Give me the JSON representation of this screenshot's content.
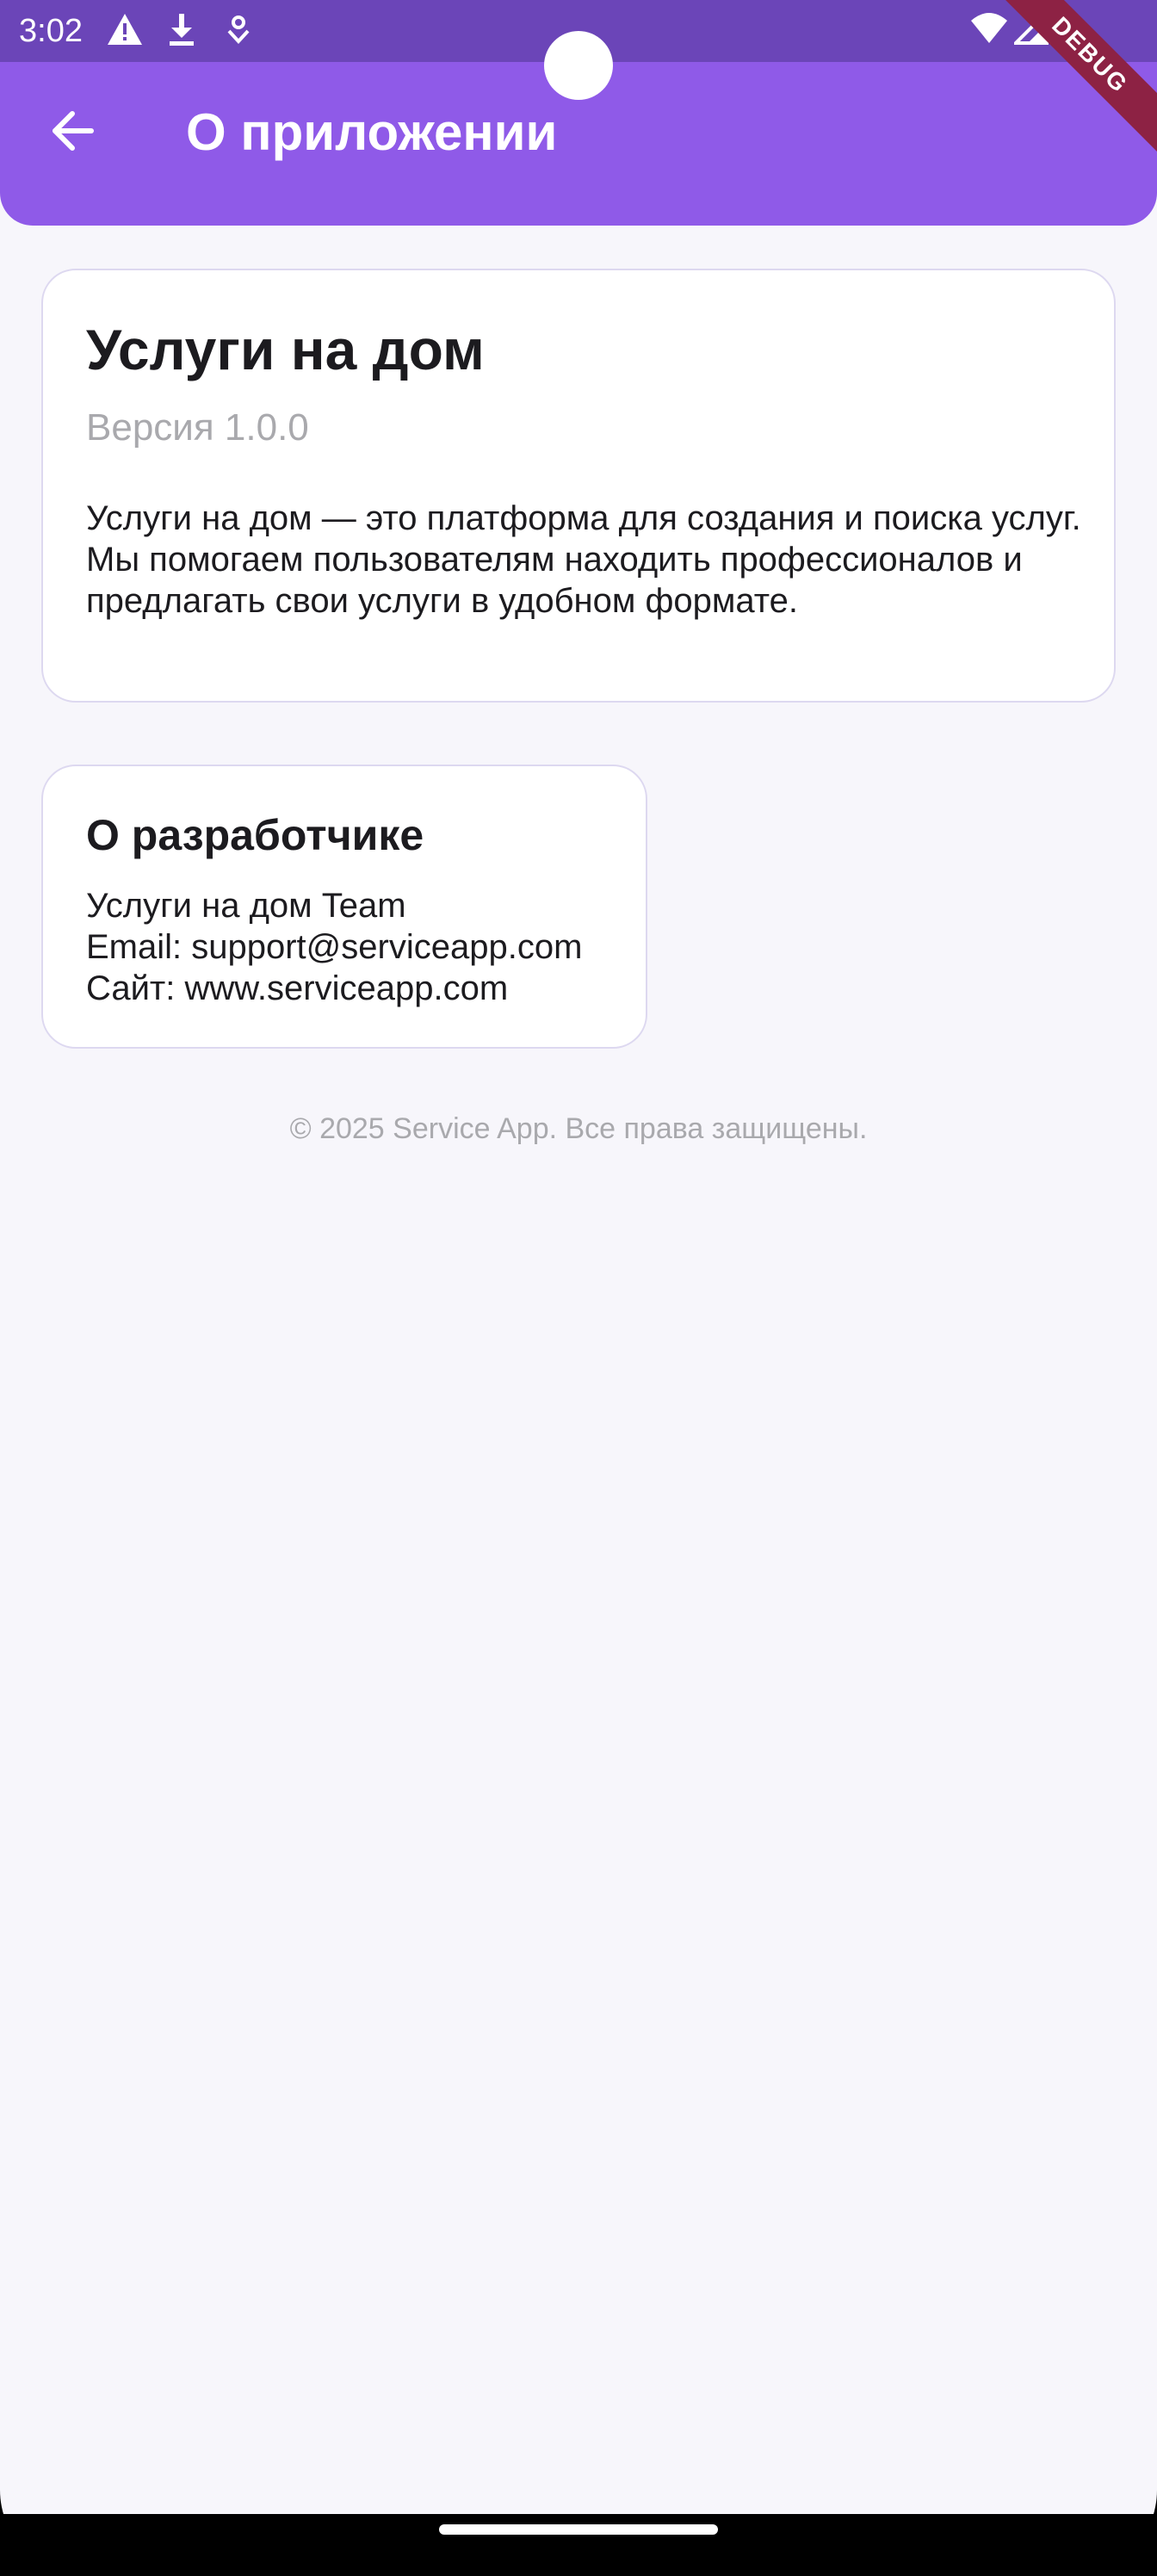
{
  "status_bar": {
    "time": "3:02",
    "left_icons": [
      "warning-icon",
      "download-icon",
      "tether-icon"
    ],
    "right_icons": [
      "wifi-icon",
      "signal-icon"
    ]
  },
  "debug_banner": "DEBUG",
  "app_bar": {
    "back_icon": "arrow-back-icon",
    "title": "О приложении",
    "color": "#8f5ae8"
  },
  "about_card": {
    "title": "Услуги на дом",
    "version": "Версия 1.0.0",
    "description": "Услуги на дом — это платформа для создания и поиска услуг. Мы помогаем пользователям находить профессионалов и предлагать свои услуги в удобном формате."
  },
  "developer_card": {
    "title": "О разработчике",
    "team": "Услуги на дом Team",
    "email": "Email: support@serviceapp.com",
    "site": "Сайт: www.serviceapp.com"
  },
  "footer": {
    "copyright": "© 2025 Service App. Все права защищены."
  },
  "colors": {
    "status_bar": "#6b45b8",
    "background": "#f7f6fb",
    "accent": "#8f5ae8",
    "debug_ribbon": "#8d2244"
  }
}
